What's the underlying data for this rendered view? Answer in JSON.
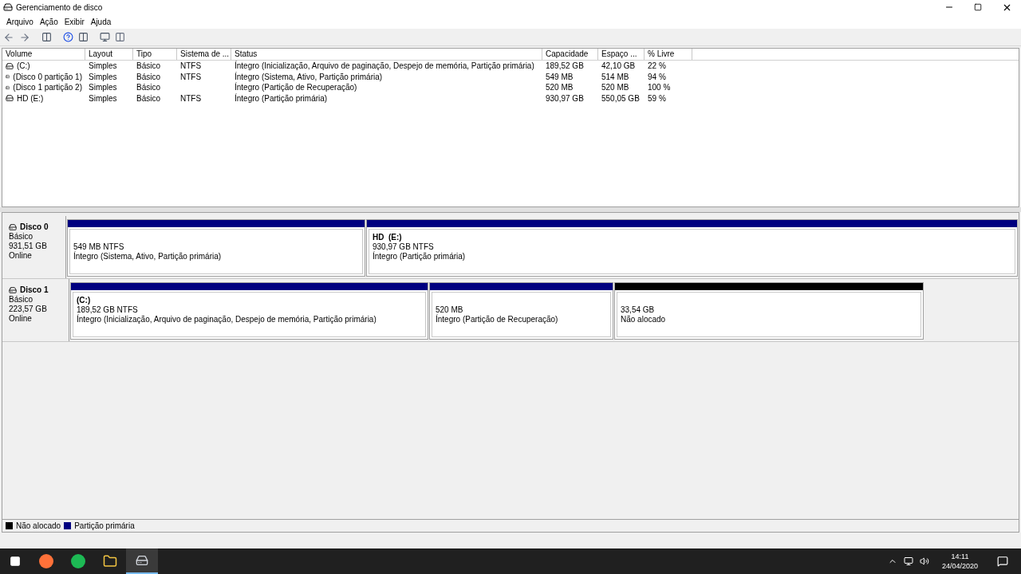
{
  "window": {
    "title": "Gerenciamento de disco"
  },
  "menu": [
    "Arquivo",
    "Ação",
    "Exibir",
    "Ajuda"
  ],
  "table": {
    "columns": [
      "Volume",
      "Layout",
      "Tipo",
      "Sistema de ...",
      "Status",
      "Capacidade",
      "Espaço ...",
      "% Livre"
    ],
    "rows": [
      [
        "(C:)",
        "Simples",
        "Básico",
        "NTFS",
        "Íntegro (Inicialização, Arquivo de paginação, Despejo de memória, Partição primária)",
        "189,52 GB",
        "42,10 GB",
        "22 %"
      ],
      [
        "(Disco 0 partição 1)",
        "Simples",
        "Básico",
        "NTFS",
        "Íntegro (Sistema, Ativo, Partição primária)",
        "549 MB",
        "514 MB",
        "94 %"
      ],
      [
        "(Disco 1 partição 2)",
        "Simples",
        "Básico",
        "",
        "Íntegro (Partição de Recuperação)",
        "520 MB",
        "520 MB",
        "100 %"
      ],
      [
        "HD (E:)",
        "Simples",
        "Básico",
        "NTFS",
        "Íntegro (Partição primária)",
        "930,97 GB",
        "550,05 GB",
        "59 %"
      ]
    ]
  },
  "disks": [
    {
      "name": "Disco 0",
      "type": "Básico",
      "size": "931,51 GB",
      "state": "Online",
      "partitions": [
        {
          "kind": "primary",
          "size": "549 MB NTFS",
          "status": "Íntegro (Sistema, Ativo, Partição primária)"
        },
        {
          "kind": "primary",
          "label": "HD  (E:)",
          "size": "930,97 GB NTFS",
          "status": "Íntegro (Partição primária)"
        }
      ]
    },
    {
      "name": "Disco 1",
      "type": "Básico",
      "size": "223,57 GB",
      "state": "Online",
      "partitions": [
        {
          "kind": "primary",
          "label": "(C:)",
          "size": "189,52 GB NTFS",
          "status": "Íntegro (Inicialização, Arquivo de paginação, Despejo de memória, Partição primária)"
        },
        {
          "kind": "primary",
          "size": "520 MB",
          "status": "Íntegro (Partição de Recuperação)"
        },
        {
          "kind": "unallocated",
          "size": "33,54 GB",
          "status": "Não alocado"
        }
      ]
    }
  ],
  "legend": [
    {
      "label": "Não alocado",
      "color": "#000000"
    },
    {
      "label": "Partição primária",
      "color": "#000080"
    }
  ],
  "taskbar": {
    "time": "14:11",
    "date": "24/04/2020"
  }
}
